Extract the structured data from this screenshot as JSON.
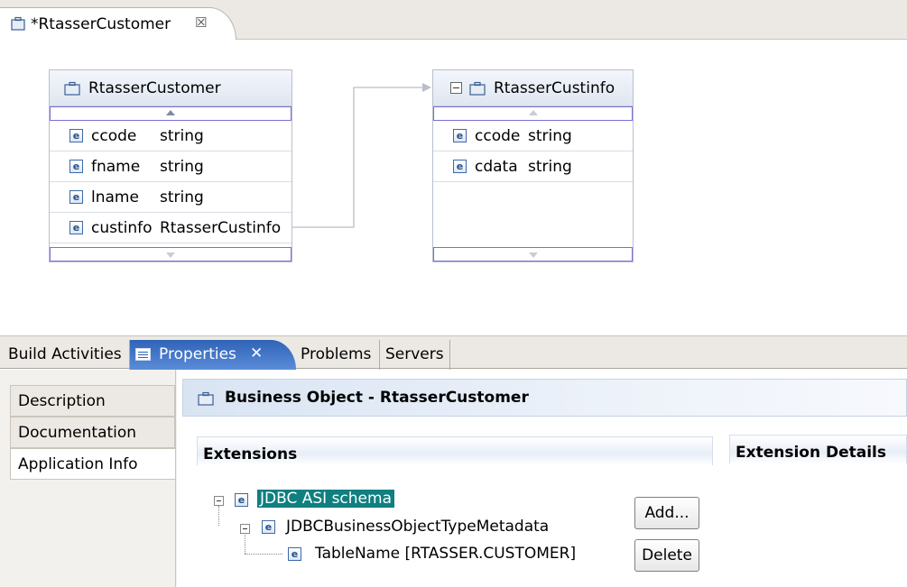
{
  "editor": {
    "tab_title": "*RtasserCustomer",
    "close_glyph": "☒"
  },
  "diagram": {
    "source_bo": {
      "title": "RtasserCustomer",
      "attributes": [
        {
          "name": "ccode",
          "type": "string"
        },
        {
          "name": "fname",
          "type": "string"
        },
        {
          "name": "lname",
          "type": "string"
        },
        {
          "name": "custinfo",
          "type": "RtasserCustinfo"
        }
      ]
    },
    "target_bo": {
      "title": "RtasserCustinfo",
      "attributes": [
        {
          "name": "ccode",
          "type": "string"
        },
        {
          "name": "cdata",
          "type": "string"
        }
      ]
    },
    "element_icon_letter": "e"
  },
  "views": {
    "tabs": [
      {
        "label": "Build Activities"
      },
      {
        "label": "Properties",
        "close_glyph": "✕"
      },
      {
        "label": "Problems"
      },
      {
        "label": "Servers"
      }
    ]
  },
  "properties": {
    "side_items": [
      {
        "label": "Description"
      },
      {
        "label": "Documentation"
      },
      {
        "label": "Application Info"
      }
    ],
    "header_title": "Business Object - RtasserCustomer",
    "extensions_title": "Extensions",
    "extension_details_title": "Extension Details",
    "tree": [
      {
        "label": "JDBC ASI schema",
        "selected": true
      },
      {
        "label": "JDBCBusinessObjectTypeMetadata"
      },
      {
        "label": "TableName [RTASSER.CUSTOMER]"
      }
    ],
    "buttons": {
      "add": "Add...",
      "delete": "Delete"
    }
  },
  "colors": {
    "accent_tab": "#2f63b7",
    "tree_selection": "#0f7f80",
    "scroll_strip_border": "#7b6fd6"
  }
}
